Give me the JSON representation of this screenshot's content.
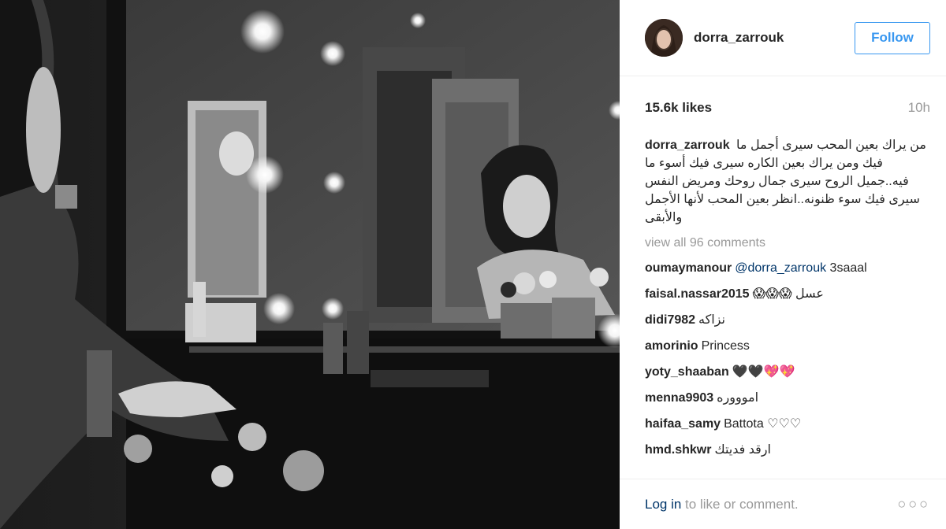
{
  "post": {
    "author": "dorra_zarrouk",
    "follow_label": "Follow",
    "likes": "15.6k likes",
    "time": "10h",
    "caption_text": "من يراك بعين المحب سيرى أجمل ما فيك ومن يراك بعين الكاره سيرى فيك أسوء ما فيه..جميل الروح سيرى جمال روحك ومريض النفس سيرى فيك سوء ظنونه..انظر بعين المحب لأنها الأجمل والأبقى",
    "view_all": "view all 96 comments",
    "comments": [
      {
        "user": "oumaymanour",
        "mention": "@dorra_zarrouk",
        "text": "3saaal"
      },
      {
        "user": "faisal.nassar2015",
        "mention": "",
        "text": "عسل 😱😱😱"
      },
      {
        "user": "didi7982",
        "mention": "",
        "text": "نزاكه"
      },
      {
        "user": "amorinio",
        "mention": "",
        "text": "Princess"
      },
      {
        "user": "yoty_shaaban",
        "mention": "",
        "text": "🖤🖤💖💖"
      },
      {
        "user": "menna9903",
        "mention": "",
        "text": "اموووره"
      },
      {
        "user": "haifaa_samy",
        "mention": "",
        "text": "Battota ♡♡♡"
      },
      {
        "user": "hmd.shkwr",
        "mention": "",
        "text": "ارقد فديتك"
      }
    ],
    "footer": {
      "login": "Log in",
      "rest": " to like or comment.",
      "more": "○○○"
    }
  },
  "icons": {
    "more": "ellipsis-icon"
  },
  "colors": {
    "accent": "#3897f0",
    "link": "#003569",
    "muted": "#999999"
  }
}
